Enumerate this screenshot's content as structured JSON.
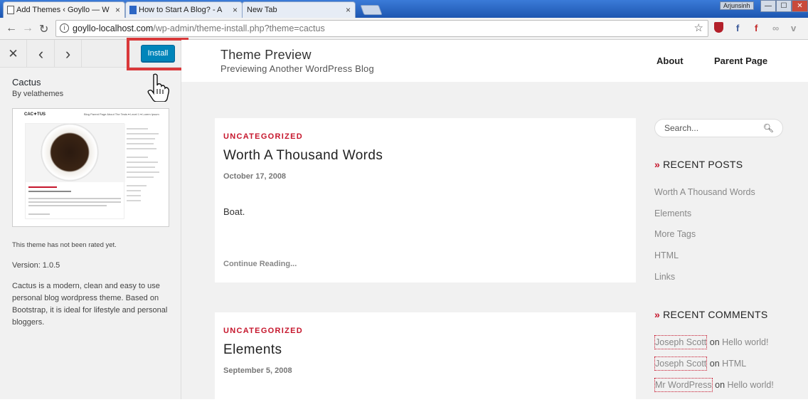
{
  "browser": {
    "tabs": [
      {
        "title": "Add Themes ‹ Goyllo — W",
        "close": "×"
      },
      {
        "title": "How to Start A Blog? - A",
        "close": "×"
      },
      {
        "title": "New Tab",
        "close": "×"
      }
    ],
    "user": "Arjunsinh",
    "window_buttons": {
      "minimize": "—",
      "maximize": "☐",
      "close": "✕"
    },
    "nav": {
      "back": "←",
      "forward": "→",
      "reload": "↻"
    },
    "url_host": "goyllo-localhost.com",
    "url_path": "/wp-admin/theme-install.php?theme=cactus",
    "star": "☆",
    "extensions": [
      "shield-extension-icon",
      "facebook-extension-icon",
      "flipboard-extension-icon",
      "link-extension-icon",
      "vine-extension-icon"
    ]
  },
  "panel": {
    "close": "✕",
    "prev": "‹",
    "next": "›",
    "install_label": "Install",
    "theme_name": "Cactus",
    "theme_author": "By velathemes",
    "screenshot": {
      "logo": "CAC✦TUS",
      "nav": "Blog   Parent Page   About The Tests ▾   Level 1 ▾   Lorem Ipsum"
    },
    "rating": "This theme has not been rated yet.",
    "version": "Version: 1.0.5",
    "description": "Cactus is a modern, clean and easy to use personal blog wordpress theme. Based on Bootstrap, it is ideal for lifestyle and personal bloggers."
  },
  "preview": {
    "site_title": "Theme Preview",
    "site_description": "Previewing Another WordPress Blog",
    "menu": [
      "About",
      "Parent Page"
    ],
    "posts": [
      {
        "category": "UNCATEGORIZED",
        "title": "Worth A Thousand Words",
        "date": "October 17, 2008",
        "excerpt": "Boat.",
        "more": "Continue Reading..."
      },
      {
        "category": "UNCATEGORIZED",
        "title": "Elements",
        "date": "September 5, 2008"
      }
    ],
    "search_placeholder": "Search...",
    "recent_posts_title": "RECENT POSTS",
    "recent_posts": [
      "Worth A Thousand Words",
      "Elements",
      "More Tags",
      "HTML",
      "Links"
    ],
    "recent_comments_title": "RECENT COMMENTS",
    "recent_comments": [
      {
        "author": "Joseph Scott",
        "on": "on",
        "target": "Hello world!"
      },
      {
        "author": "Joseph Scott",
        "on": "on",
        "target": "HTML"
      },
      {
        "author": "Mr WordPress",
        "on": "on",
        "target": "Hello world!"
      }
    ],
    "accent": "#c6162c"
  }
}
